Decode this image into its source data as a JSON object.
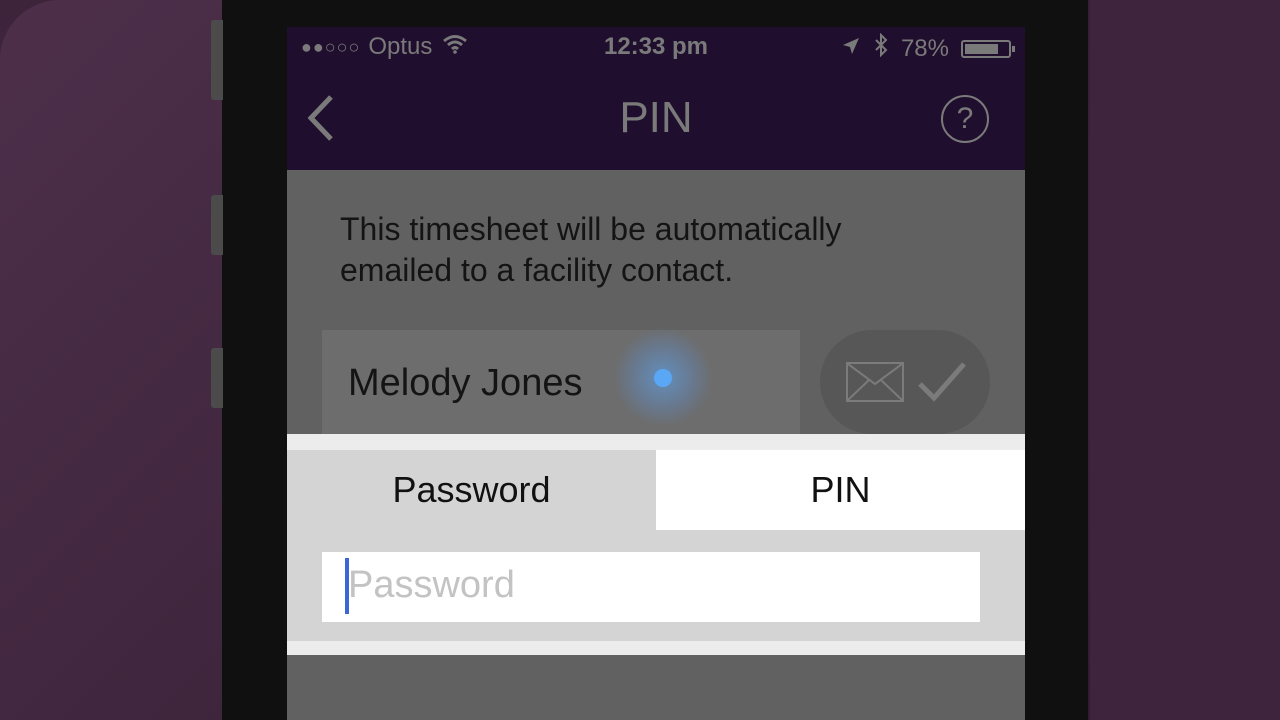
{
  "status_bar": {
    "signal": "●●○○○",
    "carrier": "Optus",
    "time": "12:33 pm",
    "battery_percent": "78%",
    "battery_level": 0.78
  },
  "nav": {
    "back_icon": "chevron-left-icon",
    "title": "PIN",
    "help_label": "?"
  },
  "info": {
    "line1": "This timesheet will be automatically",
    "line2": "emailed to a facility contact."
  },
  "contact": {
    "name": "Melody Jones"
  },
  "auth": {
    "tabs": [
      {
        "label": "Password",
        "selected": false
      },
      {
        "label": "PIN",
        "selected": true
      }
    ],
    "password_placeholder": "Password"
  },
  "colors": {
    "nav_bg": "#1f0e2e",
    "caret": "#3b66d6"
  }
}
